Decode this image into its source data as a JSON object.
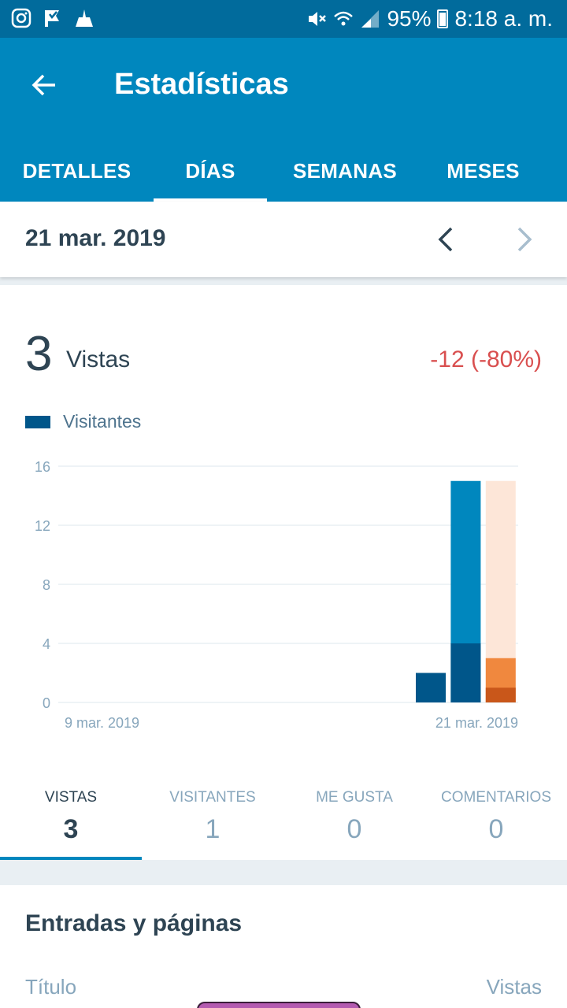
{
  "status_bar": {
    "battery": "95%",
    "time": "8:18 a. m."
  },
  "header": {
    "title": "Estadísticas"
  },
  "tabs": [
    {
      "label": "DETALLES",
      "active": false
    },
    {
      "label": "DÍAS",
      "active": true
    },
    {
      "label": "SEMANAS",
      "active": false
    },
    {
      "label": "MESES",
      "active": false
    }
  ],
  "date_nav": {
    "date": "21 mar. 2019"
  },
  "summary": {
    "value": "3",
    "label": "Vistas",
    "change": "-12 (-80%)"
  },
  "legend": {
    "label": "Visitantes"
  },
  "colors": {
    "views": "#0087be",
    "visitors": "#00568a",
    "accent": "#0087be",
    "highlight_light": "#fde6d8",
    "highlight_mid": "#f0883e",
    "highlight_dark": "#c9571a"
  },
  "chart_data": {
    "type": "bar",
    "x_labels": [
      "9 mar. 2019",
      "21 mar. 2019"
    ],
    "yticks": [
      0,
      4,
      8,
      12,
      16
    ],
    "ylim": [
      0,
      16
    ],
    "legend": "top-left",
    "grid": true,
    "series": [
      {
        "name": "Visitantes",
        "values": [
          0,
          0,
          0,
          0,
          0,
          0,
          0,
          0,
          0,
          0,
          2,
          4,
          1
        ]
      }
    ],
    "views": [
      0,
      0,
      0,
      0,
      0,
      0,
      0,
      0,
      0,
      0,
      0,
      15,
      3
    ],
    "highlighted_index": 12,
    "highlight_max": 15
  },
  "stat_tabs": [
    {
      "label": "VISTAS",
      "value": "3",
      "active": true
    },
    {
      "label": "VISITANTES",
      "value": "1",
      "active": false
    },
    {
      "label": "ME GUSTA",
      "value": "0",
      "active": false
    },
    {
      "label": "COMENTARIOS",
      "value": "0",
      "active": false
    }
  ],
  "posts": {
    "title": "Entradas y páginas",
    "col_title": "Título",
    "col_views": "Vistas"
  }
}
